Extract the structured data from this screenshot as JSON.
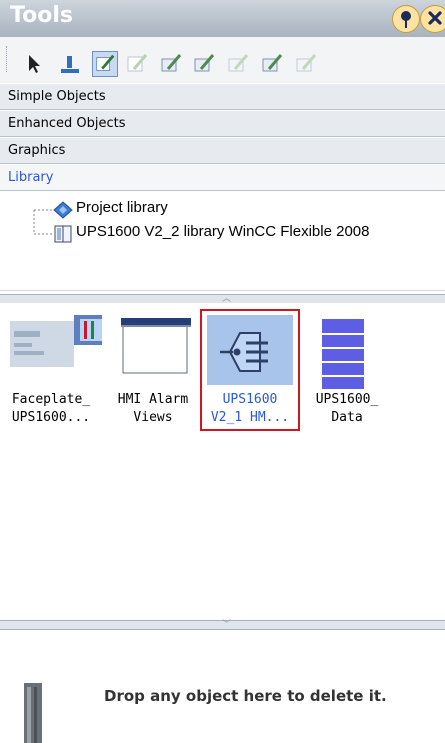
{
  "panel": {
    "title": "Tools",
    "pin_icon": "pin-icon",
    "close_icon": "close-icon"
  },
  "toolbar": {
    "icons": [
      "arrow-cursor-icon",
      "library-tool-icon",
      "edit-tool-icon",
      "edit-faded-icon",
      "edit-tool-icon",
      "edit-tool-icon",
      "edit-faded-icon",
      "edit-tool-icon",
      "edit-faded-icon"
    ]
  },
  "sections": [
    {
      "label": "Simple Objects"
    },
    {
      "label": "Enhanced Objects"
    },
    {
      "label": "Graphics"
    },
    {
      "label": "Library"
    }
  ],
  "tree": {
    "items": [
      {
        "label": "Project library",
        "icon": "project-library-icon"
      },
      {
        "label": "UPS1600 V2_2 library WinCC Flexible 2008",
        "icon": "library-book-icon"
      }
    ]
  },
  "library_items": [
    {
      "line1": "Faceplate_",
      "line2": "UPS1600...",
      "icon": "faceplate-icon",
      "selected": false
    },
    {
      "line1": "HMI Alarm",
      "line2": "Views",
      "icon": "alarm-view-icon",
      "selected": false
    },
    {
      "line1": "UPS1600",
      "line2": "V2_1 HM...",
      "icon": "library-tag-icon",
      "selected": true
    },
    {
      "line1": "UPS1600_",
      "line2": "Data",
      "icon": "data-block-icon",
      "selected": false
    }
  ],
  "drop_zone": {
    "text": "Drop any object here to delete it.",
    "icon": "trash-bin-icon"
  },
  "colors": {
    "accent": "#2a58d6",
    "selection_border": "#d0161f",
    "selection_fill": "#a9c4ea"
  }
}
